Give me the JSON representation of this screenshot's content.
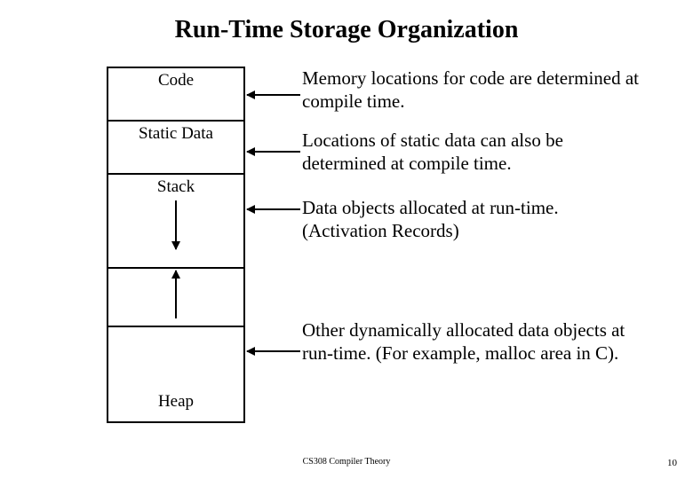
{
  "title": "Run-Time Storage Organization",
  "segments": {
    "code": "Code",
    "static": "Static Data",
    "stack": "Stack",
    "heap": "Heap"
  },
  "explanations": {
    "code": "Memory locations for code are determined at compile time.",
    "static": "Locations of static data can also be determined at compile time.",
    "stack": "Data objects allocated at run-time. (Activation Records)",
    "heap": "Other dynamically allocated data objects at run-time. (For example, malloc area in C)."
  },
  "footer": "CS308 Compiler Theory",
  "page_number": "10"
}
